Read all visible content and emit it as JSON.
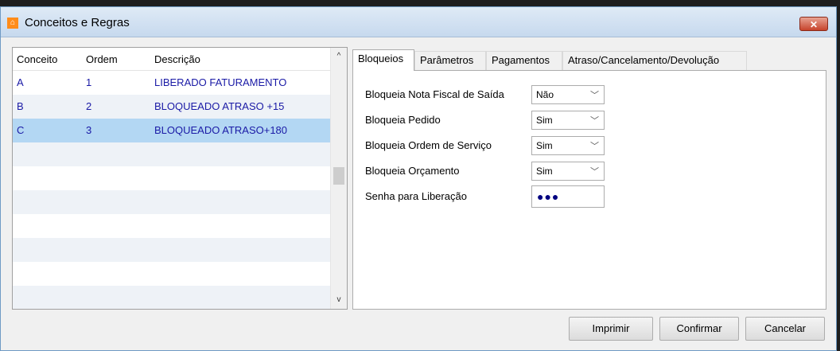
{
  "window": {
    "title": "Conceitos e Regras",
    "close_label": "✕"
  },
  "grid": {
    "columns": [
      "Conceito",
      "Ordem",
      "Descrição"
    ],
    "rows": [
      {
        "conceito": "A",
        "ordem": "1",
        "descricao": "LIBERADO FATURAMENTO"
      },
      {
        "conceito": "B",
        "ordem": "2",
        "descricao": "BLOQUEADO ATRASO +15"
      },
      {
        "conceito": "C",
        "ordem": "3",
        "descricao": "BLOQUEADO ATRASO+180"
      }
    ],
    "selected_row": 2,
    "scroll_up": "^",
    "scroll_down": "v"
  },
  "tabs": [
    "Bloqueios",
    "Parâmetros",
    "Pagamentos",
    "Atraso/Cancelamento/Devolução"
  ],
  "form": {
    "fields": [
      {
        "label": "Bloqueia Nota Fiscal de Saída",
        "value": "Não"
      },
      {
        "label": "Bloqueia Pedido",
        "value": "Sim"
      },
      {
        "label": "Bloqueia Ordem de Serviço",
        "value": "Sim"
      },
      {
        "label": "Bloqueia Orçamento",
        "value": "Sim"
      }
    ],
    "password": {
      "label": "Senha para Liberação",
      "mask": "●●●"
    }
  },
  "buttons": {
    "print": "Imprimir",
    "confirm": "Confirmar",
    "cancel": "Cancelar"
  },
  "colors": {
    "title_bar": "#c6d9ee",
    "selection": "#b3d7f3",
    "grid_text": "#1a1aa6",
    "close_button": "#c7432b"
  }
}
